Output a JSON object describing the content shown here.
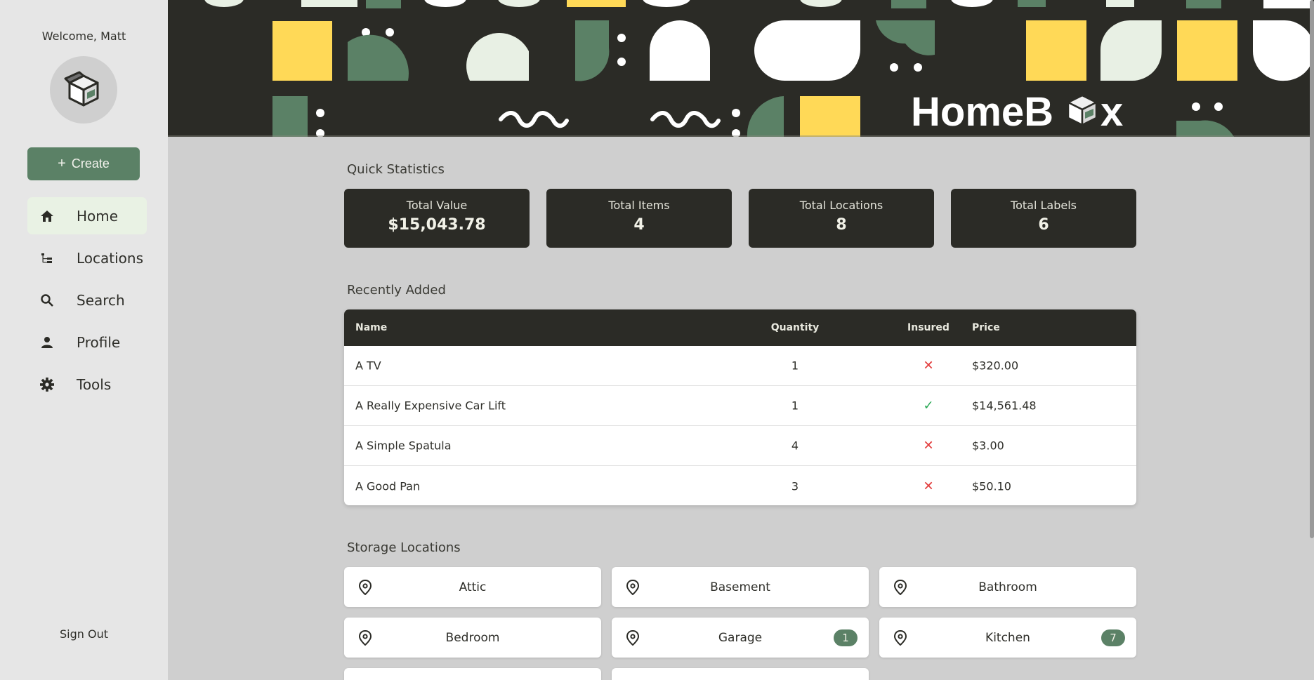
{
  "sidebar": {
    "welcome": "Welcome, Matt",
    "create_label": "Create",
    "nav": [
      {
        "label": "Home",
        "icon": "home-icon",
        "active": true
      },
      {
        "label": "Locations",
        "icon": "tree-icon"
      },
      {
        "label": "Search",
        "icon": "search-icon"
      },
      {
        "label": "Profile",
        "icon": "person-icon"
      },
      {
        "label": "Tools",
        "icon": "gear-icon"
      }
    ],
    "sign_out": "Sign Out"
  },
  "banner": {
    "logo_text": "HomeBox"
  },
  "stats": {
    "title": "Quick Statistics",
    "items": [
      {
        "label": "Total Value",
        "value": "$15,043.78"
      },
      {
        "label": "Total Items",
        "value": "4"
      },
      {
        "label": "Total Locations",
        "value": "8"
      },
      {
        "label": "Total Labels",
        "value": "6"
      }
    ]
  },
  "recent": {
    "title": "Recently Added",
    "headers": {
      "name": "Name",
      "quantity": "Quantity",
      "insured": "Insured",
      "price": "Price"
    },
    "rows": [
      {
        "name": "A TV",
        "quantity": "1",
        "insured": false,
        "price": "$320.00"
      },
      {
        "name": "A Really Expensive Car Lift",
        "quantity": "1",
        "insured": true,
        "price": "$14,561.48"
      },
      {
        "name": "A Simple Spatula",
        "quantity": "4",
        "insured": false,
        "price": "$3.00"
      },
      {
        "name": "A Good Pan",
        "quantity": "3",
        "insured": false,
        "price": "$50.10"
      }
    ]
  },
  "locations": {
    "title": "Storage Locations",
    "items": [
      {
        "name": "Attic",
        "count": ""
      },
      {
        "name": "Basement",
        "count": ""
      },
      {
        "name": "Bathroom",
        "count": ""
      },
      {
        "name": "Bedroom",
        "count": ""
      },
      {
        "name": "Garage",
        "count": "1"
      },
      {
        "name": "Kitchen",
        "count": "7"
      }
    ]
  },
  "colors": {
    "accent": "#5b8166",
    "dark": "#2b2b26",
    "yellow": "#ffd957",
    "mint": "#e8f0e4",
    "insured_yes": "#2aa855",
    "insured_no": "#e23b3b"
  }
}
